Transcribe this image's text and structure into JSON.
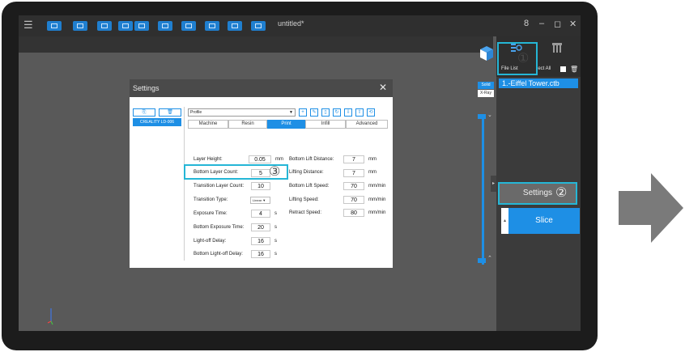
{
  "window": {
    "title": "untitled*",
    "controls": [
      "8",
      "–",
      "◻",
      "✕"
    ]
  },
  "toolbar": {
    "menu_icon": "☰",
    "buttons": [
      "open",
      "save",
      "import",
      "view1",
      "view2",
      "view3",
      "view4",
      "view5",
      "view6",
      "view7"
    ]
  },
  "view": {
    "solid_label": "Solid",
    "xray_label": "X-Ray"
  },
  "right_panel": {
    "file_list_label": "File List",
    "select_all_label": "lect All",
    "file_item": "1.-Eiffel Tower.ctb",
    "settings_label": "Settings",
    "slice_label": "Slice",
    "tab_icons": [
      "settings-icon",
      "model-icon"
    ]
  },
  "dialog": {
    "title": "Settings",
    "close": "✕",
    "left_profile": "CREALITY LD-006",
    "profile_select": "Profile",
    "tabs": [
      "Machine",
      "Resin",
      "Print",
      "Infill",
      "Advanced"
    ],
    "active_tab": "Print",
    "fields_left": [
      {
        "label": "Layer Height:",
        "value": "0.05",
        "unit": "mm"
      },
      {
        "label": "Bottom Layer Count:",
        "value": "5",
        "unit": ""
      },
      {
        "label": "Transition Layer Count:",
        "value": "10",
        "unit": ""
      },
      {
        "label": "Transition Type:",
        "value": "Linear",
        "unit": ""
      },
      {
        "label": "Exposure Time:",
        "value": "4",
        "unit": "s"
      },
      {
        "label": "Bottom Exposure Time:",
        "value": "20",
        "unit": "s"
      },
      {
        "label": "Light-off Delay:",
        "value": "16",
        "unit": "s"
      },
      {
        "label": "Bottom Light-off Delay:",
        "value": "16",
        "unit": "s"
      }
    ],
    "fields_right": [
      {
        "label": "Bottom Lift Distance:",
        "value": "7",
        "unit": "mm"
      },
      {
        "label": "Lifting Distance:",
        "value": "7",
        "unit": "mm"
      },
      {
        "label": "Bottom Lift Speed:",
        "value": "70",
        "unit": "mm/min"
      },
      {
        "label": "Lifting Speed:",
        "value": "70",
        "unit": "mm/min"
      },
      {
        "label": "Retract Speed:",
        "value": "80",
        "unit": "mm/min"
      }
    ]
  },
  "annotations": {
    "one": "①",
    "two": "②",
    "three": "③"
  },
  "colors": {
    "accent": "#1e8fe5",
    "highlight": "#25b6d6",
    "arrow": "#7a7a7a"
  }
}
